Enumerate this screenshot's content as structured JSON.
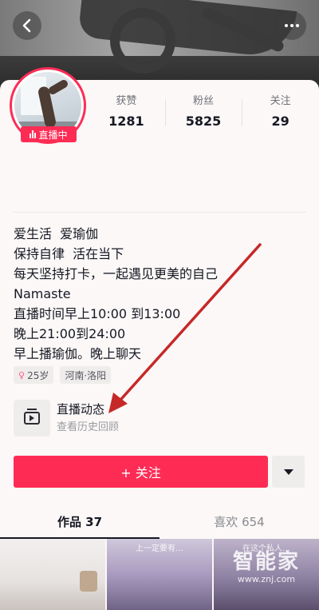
{
  "profile": {
    "live_badge": "直播中",
    "stats": [
      {
        "label": "获赞",
        "value": "1281"
      },
      {
        "label": "粉丝",
        "value": "5825"
      },
      {
        "label": "关注",
        "value": "29"
      }
    ],
    "bio_lines": [
      "爱生活  爱瑜伽",
      "保持自律  活在当下",
      "每天坚持打卡，一起遇见更美的自己",
      "Namaste",
      "直播时间早上10:00 到13:00",
      "晚上21:00到24:00",
      "早上播瑜伽。晚上聊天"
    ],
    "tags": {
      "age": "25岁",
      "location": "河南·洛阳"
    }
  },
  "live_dynamic": {
    "title": "直播动态",
    "subtitle": "查看历史回顾"
  },
  "actions": {
    "follow_label": "+ 关注"
  },
  "tabs": [
    {
      "label": "作品 37"
    },
    {
      "label": "喜欢 654"
    }
  ],
  "thumbnails": [
    {
      "caption": ""
    },
    {
      "caption": "上一定要有…"
    },
    {
      "caption": "在这个私人…"
    }
  ],
  "watermark": {
    "title": "智能家",
    "url": "www.znj.com"
  },
  "colors": {
    "accent": "#fe2c55",
    "arrow": "#c62828"
  }
}
